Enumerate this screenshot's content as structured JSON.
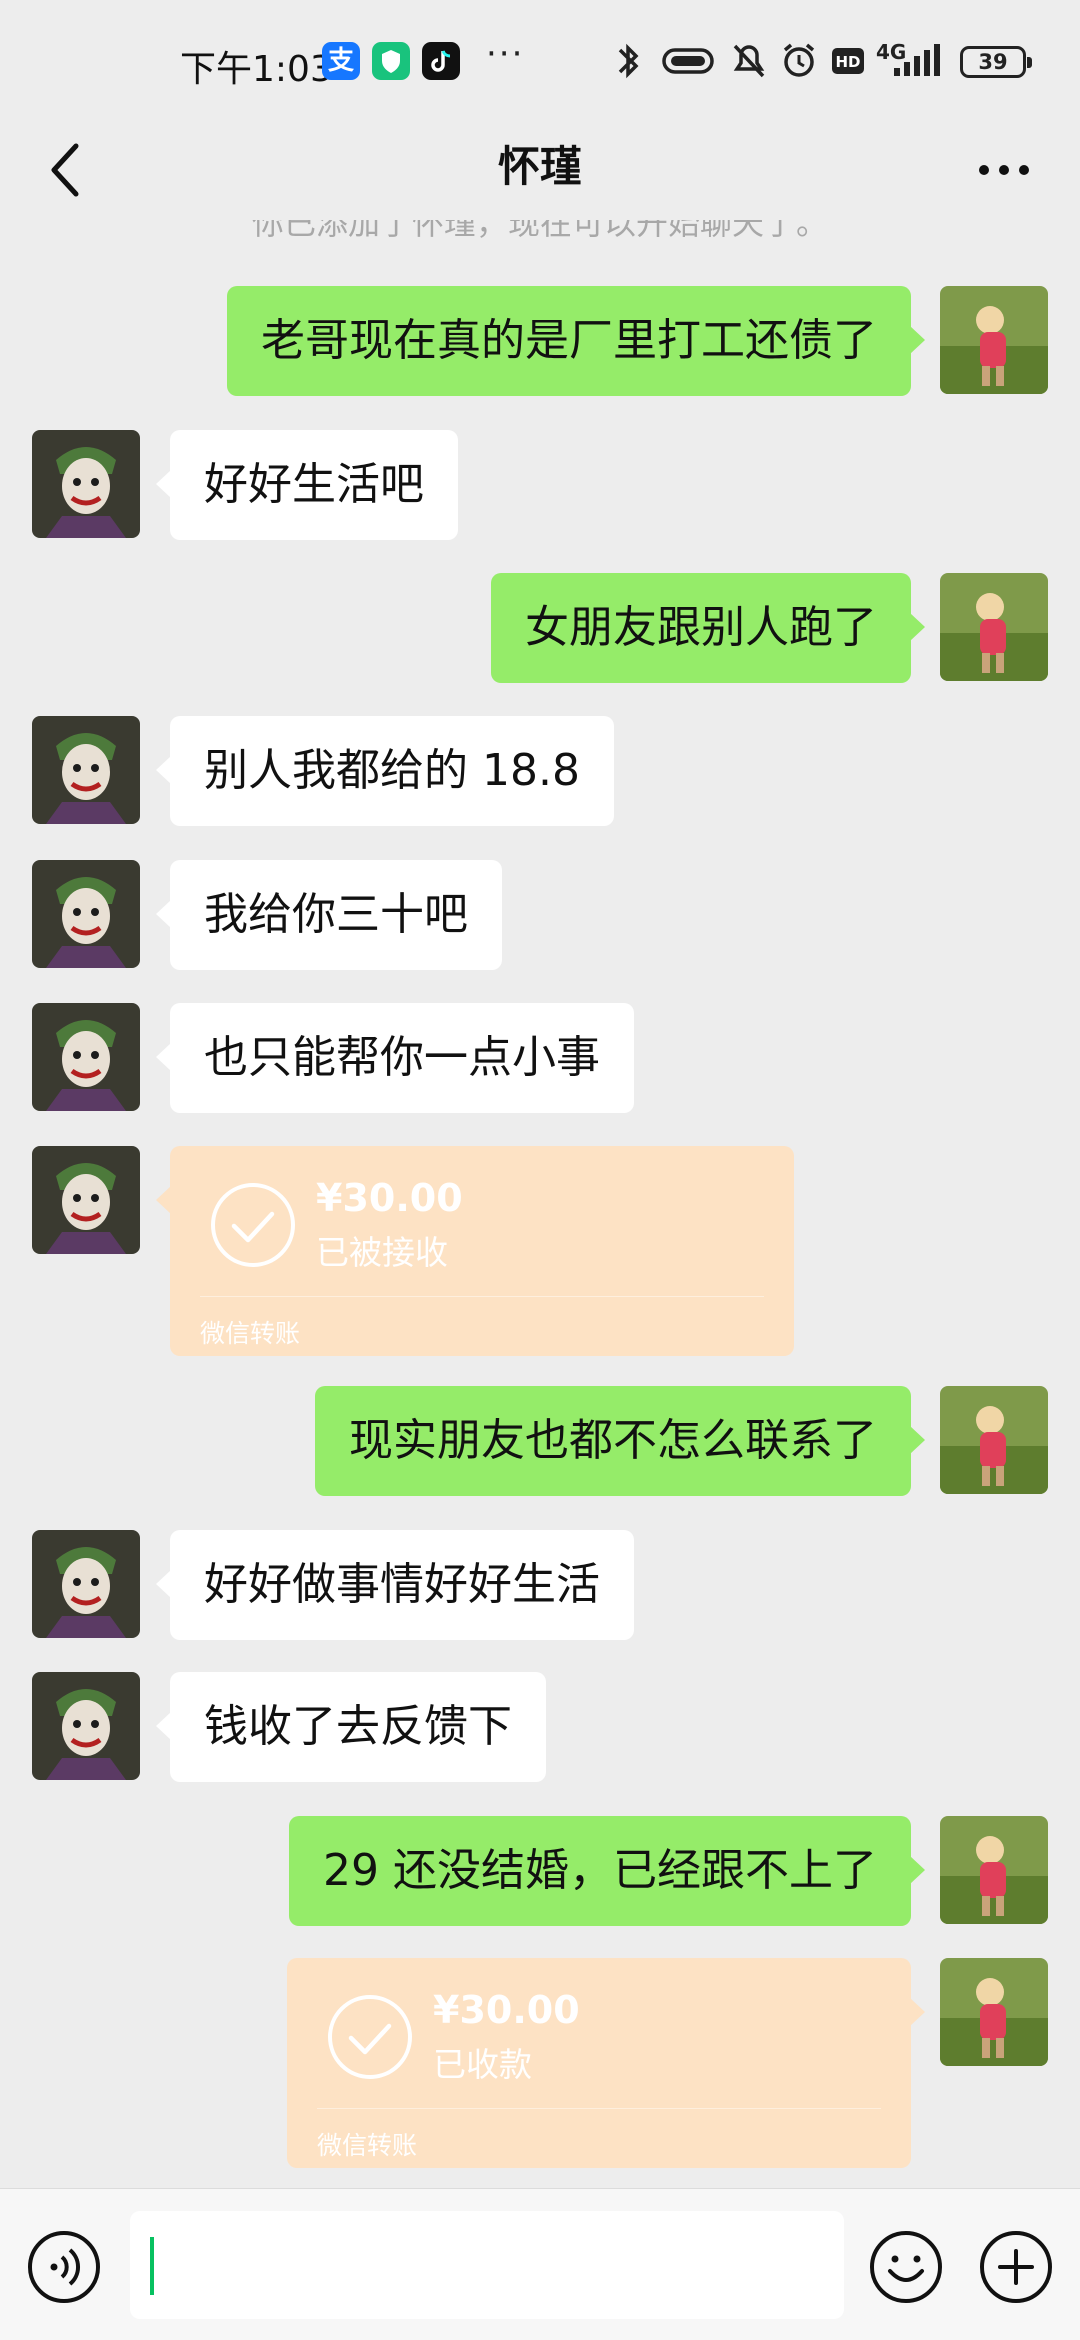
{
  "status_bar": {
    "time": "下午1:03",
    "network": "4G",
    "battery": "39",
    "more": "···",
    "icons": [
      "alipay-icon",
      "shield-app-icon",
      "tiktok-icon",
      "bluetooth-icon",
      "vibrate-icon",
      "mute-icon",
      "alarm-icon",
      "hd-icon",
      "signal-icon",
      "battery-icon"
    ]
  },
  "header": {
    "title": "怀瑾",
    "back_icon": "chevron-left-icon",
    "more_icon": "more-dots-icon"
  },
  "chat": {
    "system_note": "你已添加了怀瑾，现在可以开始聊天了。",
    "messages": [
      {
        "from": "me",
        "text": "老哥现在真的是厂里打工还债了"
      },
      {
        "from": "other",
        "text": "好好生活吧"
      },
      {
        "from": "me",
        "text": "女朋友跟别人跑了"
      },
      {
        "from": "other",
        "text": "别人我都给的 18.8"
      },
      {
        "from": "other",
        "text": "我给你三十吧"
      },
      {
        "from": "other",
        "text": "也只能帮你一点小事"
      },
      {
        "from": "other",
        "type": "transfer",
        "amount": "¥30.00",
        "status": "已被接收",
        "label": "微信转账"
      },
      {
        "from": "me",
        "text": "现实朋友也都不怎么联系了"
      },
      {
        "from": "other",
        "text": "好好做事情好好生活"
      },
      {
        "from": "other",
        "text": "钱收了去反馈下"
      },
      {
        "from": "me",
        "text": "29 还没结婚，已经跟不上了"
      },
      {
        "from": "me",
        "type": "transfer",
        "amount": "¥30.00",
        "status": "已收款",
        "label": "微信转账"
      }
    ]
  },
  "input_bar": {
    "voice_icon": "voice-icon",
    "emoji_icon": "emoji-icon",
    "plus_icon": "plus-icon",
    "value": ""
  },
  "colors": {
    "background": "#ededed",
    "bubble_me": "#95ec69",
    "bubble_other": "#ffffff",
    "transfer": "#fde2c4",
    "accent": "#07c160"
  }
}
